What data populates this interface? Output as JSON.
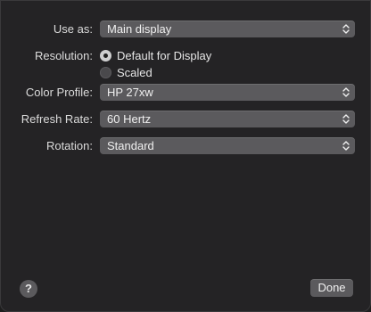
{
  "fields": {
    "use_as": {
      "label": "Use as:",
      "value": "Main display"
    },
    "resolution": {
      "label": "Resolution:",
      "options": [
        {
          "label": "Default for Display",
          "selected": true
        },
        {
          "label": "Scaled",
          "selected": false
        }
      ]
    },
    "color_profile": {
      "label": "Color Profile:",
      "value": "HP 27xw"
    },
    "refresh_rate": {
      "label": "Refresh Rate:",
      "value": "60 Hertz"
    },
    "rotation": {
      "label": "Rotation:",
      "value": "Standard"
    }
  },
  "footer": {
    "help_label": "?",
    "done_label": "Done"
  },
  "colors": {
    "background": "#242325",
    "control": "#5b5a5d",
    "text": "#dcdcdc"
  }
}
